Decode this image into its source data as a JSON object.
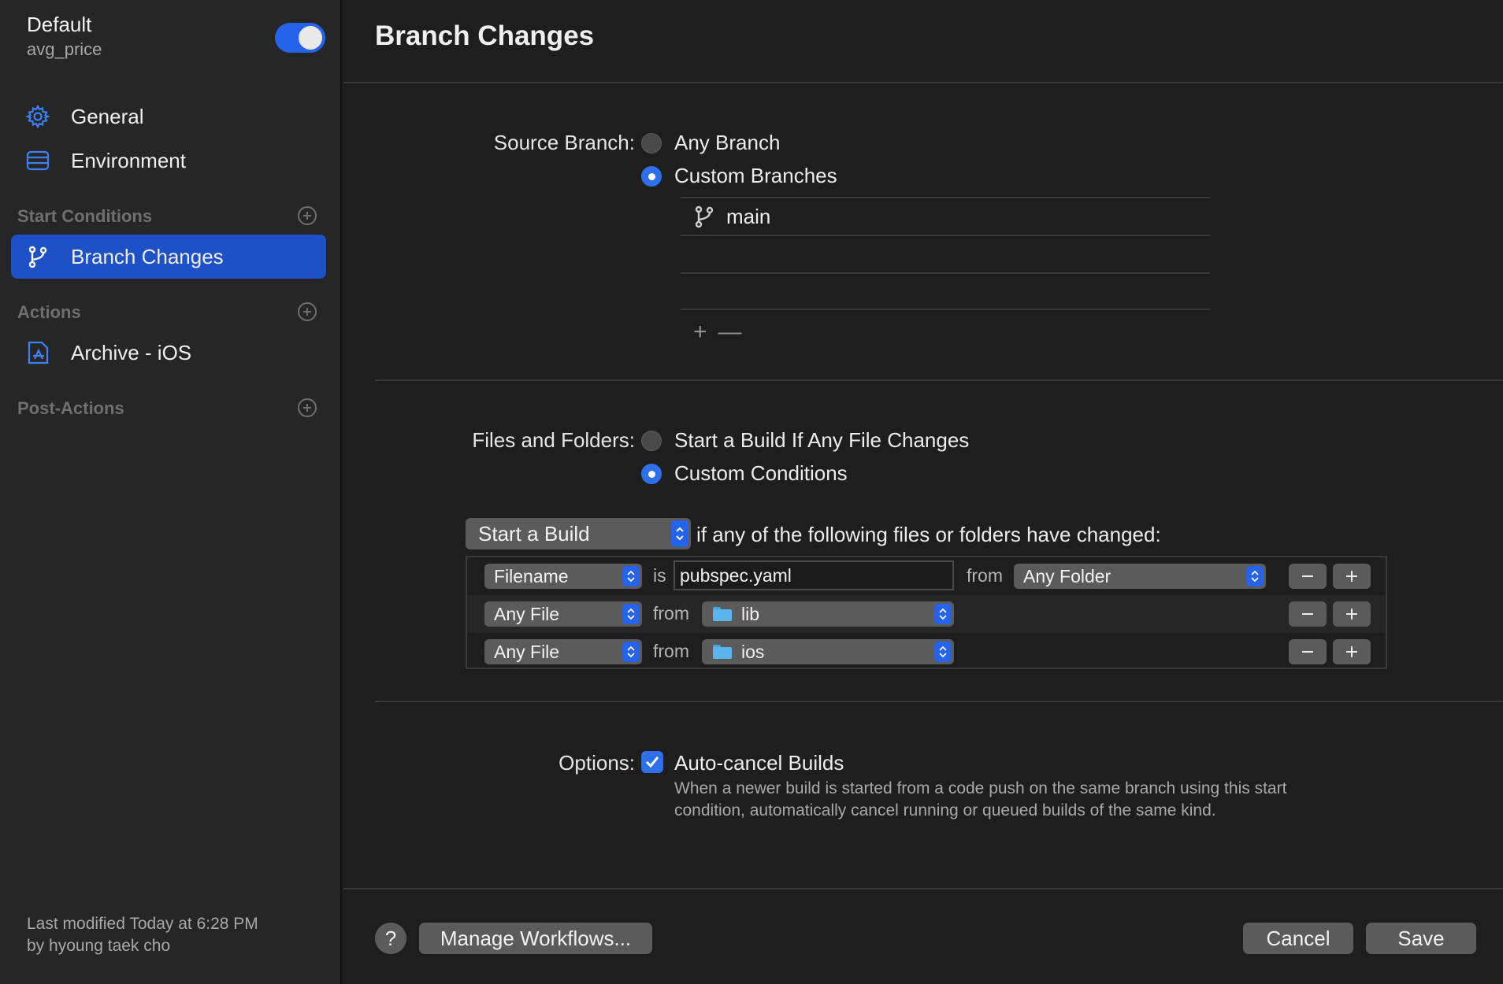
{
  "workflow": {
    "name": "Default",
    "product": "avg_price",
    "enabled": true
  },
  "sidebar": {
    "items": [
      {
        "label": "General",
        "icon": "gear-icon"
      },
      {
        "label": "Environment",
        "icon": "server-icon"
      }
    ],
    "sections": [
      {
        "title": "Start Conditions",
        "items": [
          {
            "label": "Branch Changes",
            "icon": "branch-icon",
            "selected": true
          }
        ]
      },
      {
        "title": "Actions",
        "items": [
          {
            "label": "Archive - iOS",
            "icon": "app-store-icon"
          }
        ]
      },
      {
        "title": "Post-Actions",
        "items": []
      }
    ],
    "modified_line1": "Last modified Today at 6:28 PM",
    "modified_line2": "by hyoung taek cho"
  },
  "main": {
    "title": "Branch Changes",
    "source_branch": {
      "label": "Source Branch:",
      "options": [
        {
          "label": "Any Branch",
          "selected": false
        },
        {
          "label": "Custom Branches",
          "selected": true
        }
      ],
      "branches": [
        "main"
      ],
      "add_symbol": "+",
      "remove_symbol": "—"
    },
    "files": {
      "label": "Files and Folders:",
      "options": [
        {
          "label": "Start a Build If Any File Changes",
          "selected": false
        },
        {
          "label": "Custom Conditions",
          "selected": true
        }
      ],
      "build_select": "Start a Build",
      "build_text": "if any of the following files or folders have changed:",
      "conditions": [
        {
          "type": "Filename",
          "word": "is",
          "value": "pubspec.yaml",
          "from": "from",
          "folder": "Any Folder"
        },
        {
          "type": "Any File",
          "from": "from",
          "folder": "lib"
        },
        {
          "type": "Any File",
          "from": "from",
          "folder": "ios"
        }
      ]
    },
    "options": {
      "label": "Options:",
      "checkbox_label": "Auto-cancel Builds",
      "checked": true,
      "desc_line1": "When a newer build is started from a code push on the same branch using this start",
      "desc_line2": "condition, automatically cancel running or queued builds of the same kind."
    }
  },
  "footer": {
    "help": "?",
    "manage": "Manage Workflows...",
    "cancel": "Cancel",
    "save": "Save"
  },
  "colors": {
    "accent": "#2563eb",
    "selected": "#1e50c8",
    "background": "#1e1e1e",
    "sidebar": "#262626"
  }
}
